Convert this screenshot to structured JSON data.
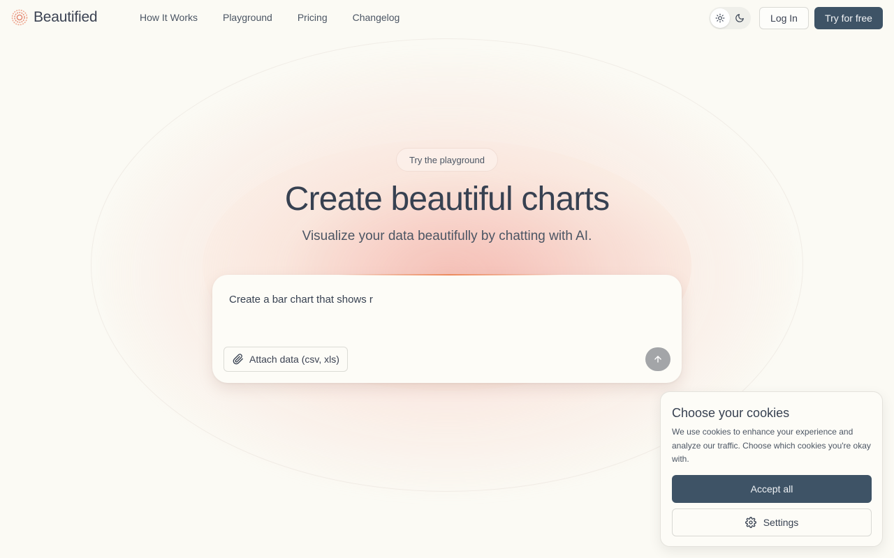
{
  "header": {
    "brand": "Beautified",
    "nav": [
      {
        "label": "How It Works"
      },
      {
        "label": "Playground"
      },
      {
        "label": "Pricing"
      },
      {
        "label": "Changelog"
      }
    ],
    "theme": {
      "light_icon": "sun-icon",
      "dark_icon": "moon-icon",
      "selected": "light"
    },
    "login_label": "Log In",
    "try_label": "Try for free"
  },
  "hero": {
    "pill": "Try the playground",
    "title": "Create beautiful charts",
    "subtitle": "Visualize your data beautifully by chatting with AI."
  },
  "prompt": {
    "value": "Create a bar chart that shows r",
    "attach_label": "Attach data (csv, xls)",
    "attach_icon": "paperclip-icon",
    "send_icon": "arrow-up-icon"
  },
  "cookies": {
    "title": "Choose your cookies",
    "body": "We use cookies to enhance your experience and analyze our traffic. Choose which cookies you're okay with.",
    "accept_label": "Accept all",
    "settings_label": "Settings",
    "settings_icon": "gear-icon"
  },
  "colors": {
    "background": "#fbfaf4",
    "primary_button": "#3e5366",
    "accent": "#ec8250"
  }
}
